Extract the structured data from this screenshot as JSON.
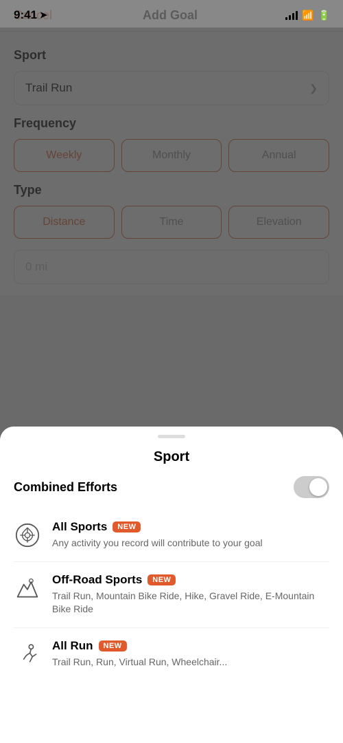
{
  "statusBar": {
    "time": "9:41",
    "navigationArrow": "➤"
  },
  "navBar": {
    "cancelLabel": "Cancel",
    "title": "Add Goal",
    "placeholder": ""
  },
  "sportSection": {
    "label": "Sport",
    "selectedSport": "Trail Run",
    "chevron": "⌄"
  },
  "frequencySection": {
    "label": "Frequency",
    "options": [
      "Weekly",
      "Monthly",
      "Annual"
    ],
    "activeIndex": 0
  },
  "typeSection": {
    "label": "Type",
    "options": [
      "Distance",
      "Time",
      "Elevation"
    ],
    "activeIndex": 0
  },
  "distanceInput": {
    "placeholder": "0 mi"
  },
  "bottomSheet": {
    "title": "Sport",
    "combinedEffortsLabel": "Combined Efforts",
    "sportOptions": [
      {
        "name": "All Sports",
        "badge": "NEW",
        "description": "Any activity you record will contribute to your goal",
        "iconType": "all-sports"
      },
      {
        "name": "Off-Road Sports",
        "badge": "NEW",
        "description": "Trail Run, Mountain Bike Ride, Hike, Gravel Ride, E-Mountain Bike Ride",
        "iconType": "off-road"
      },
      {
        "name": "All Run",
        "badge": "NEW",
        "description": "Trail Run, Run, Virtual Run, Wheelchair...",
        "iconType": "all-run"
      }
    ]
  }
}
